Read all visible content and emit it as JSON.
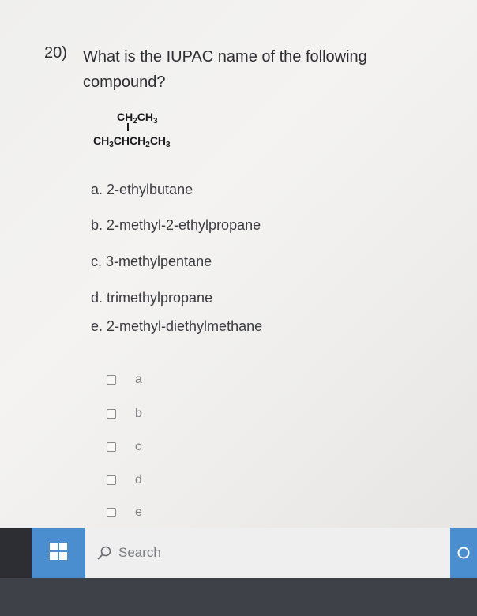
{
  "question": {
    "number": "20)",
    "text": "What is the IUPAC name of the following compound?"
  },
  "structure": {
    "branch": [
      "CH",
      "2",
      "CH",
      "3"
    ],
    "chain": [
      "CH",
      "3",
      "CHCH",
      "2",
      "CH",
      "3"
    ]
  },
  "options": [
    "a. 2-ethylbutane",
    "b. 2-methyl-2-ethylpropane",
    "c. 3-methylpentane",
    "d. trimethylpropane",
    "e. 2-methyl-diethylmethane"
  ],
  "choices": [
    "a",
    "b",
    "c",
    "d",
    "e"
  ],
  "taskbar": {
    "search_text": "Search",
    "colors": {
      "accent": "#4b8ed0",
      "bar": "#2c2e34"
    }
  }
}
